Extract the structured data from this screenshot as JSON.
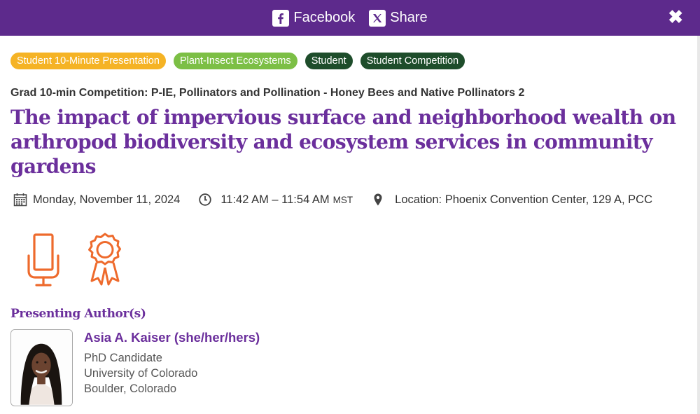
{
  "share_bar": {
    "facebook_label": "Facebook",
    "share_label": "Share",
    "close_symbol": "✖",
    "bg_color": "#5d2a8c"
  },
  "tags": [
    {
      "label": "Student 10-Minute Presentation",
      "color": "#f5b325"
    },
    {
      "label": "Plant-Insect Ecosystems",
      "color": "#7cbf45"
    },
    {
      "label": "Student",
      "color": "#1e4d2b"
    },
    {
      "label": "Student Competition",
      "color": "#1e4d2b"
    }
  ],
  "session": "Grad 10-min Competition: P-IE, Pollinators and Pollination - Honey Bees and Native Pollinators 2",
  "title": "The impact of impervious surface and neighborhood wealth on arthropod biodiversity and ecosystem services in community gardens",
  "meta": {
    "date": "Monday, November 11, 2024",
    "time": "11:42 AM – 11:54 AM",
    "timezone": "MST",
    "location": "Location: Phoenix Convention Center, 129 A, PCC"
  },
  "badges": [
    {
      "icon": "microphone-icon",
      "color": "#ee6a2c"
    },
    {
      "icon": "award-ribbon-icon",
      "color": "#ee6a2c"
    }
  ],
  "presenting_authors_heading": "Presenting Author(s)",
  "author": {
    "name": "Asia A. Kaiser (she/her/hers)",
    "role": "PhD Candidate",
    "affiliation": "University of Colorado",
    "location": "Boulder, Colorado"
  },
  "accent_color": "#6b2f9c"
}
